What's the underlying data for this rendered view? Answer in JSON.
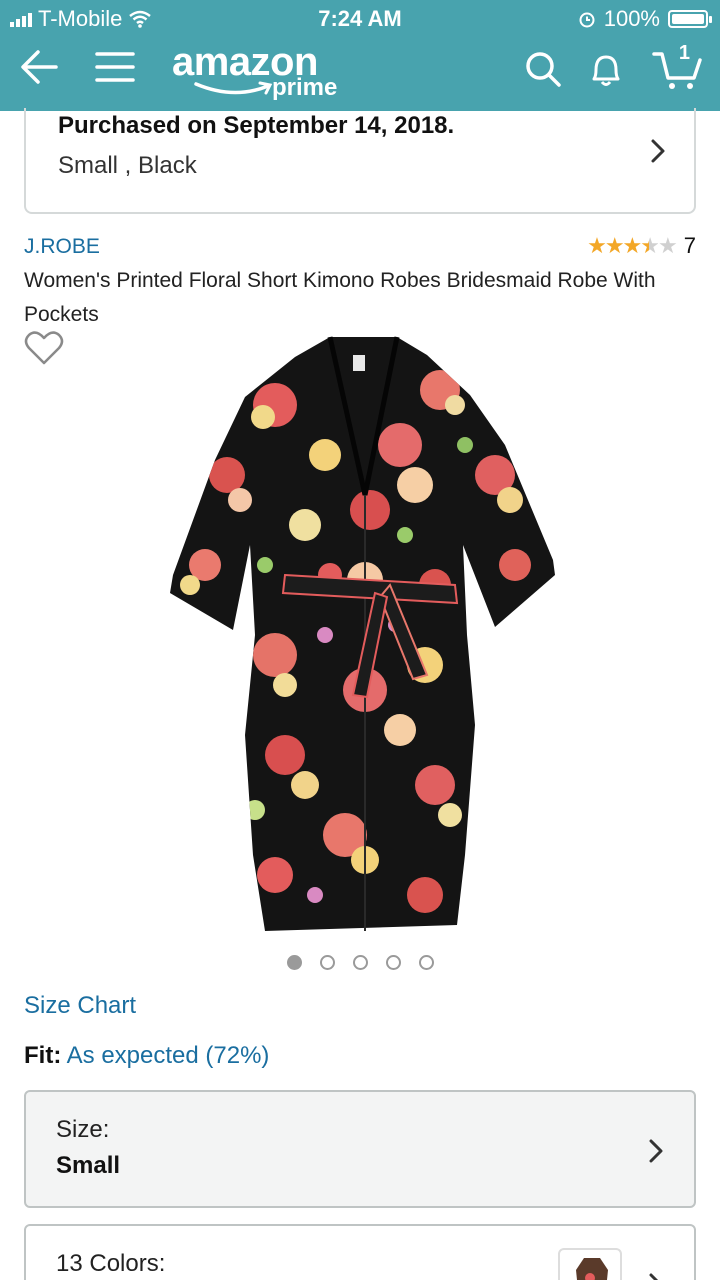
{
  "status_bar": {
    "carrier": "T-Mobile",
    "time": "7:24 AM",
    "battery": "100%",
    "battery_level": 1.0
  },
  "nav": {
    "logo_text": "amazon",
    "logo_sub": "prime",
    "cart_count": "1"
  },
  "purchase": {
    "title": "Purchased on September 14, 2018.",
    "variant": "Small , Black"
  },
  "product": {
    "brand": "J.ROBE",
    "rating_stars": 3.5,
    "rating_count": "7",
    "title": "Women's Printed Floral Short Kimono Robes Bridesmaid Robe With Pockets",
    "image_count": 5,
    "active_image": 0
  },
  "size_chart_link": "Size Chart",
  "fit": {
    "label": "Fit:",
    "value": "As expected (72%)"
  },
  "size_selector": {
    "label": "Size:",
    "value": "Small"
  },
  "color_selector": {
    "label": "13 Colors:"
  },
  "colors": {
    "header": "#48A3AE",
    "link": "#1A6EA0",
    "star": "#F3A727"
  }
}
